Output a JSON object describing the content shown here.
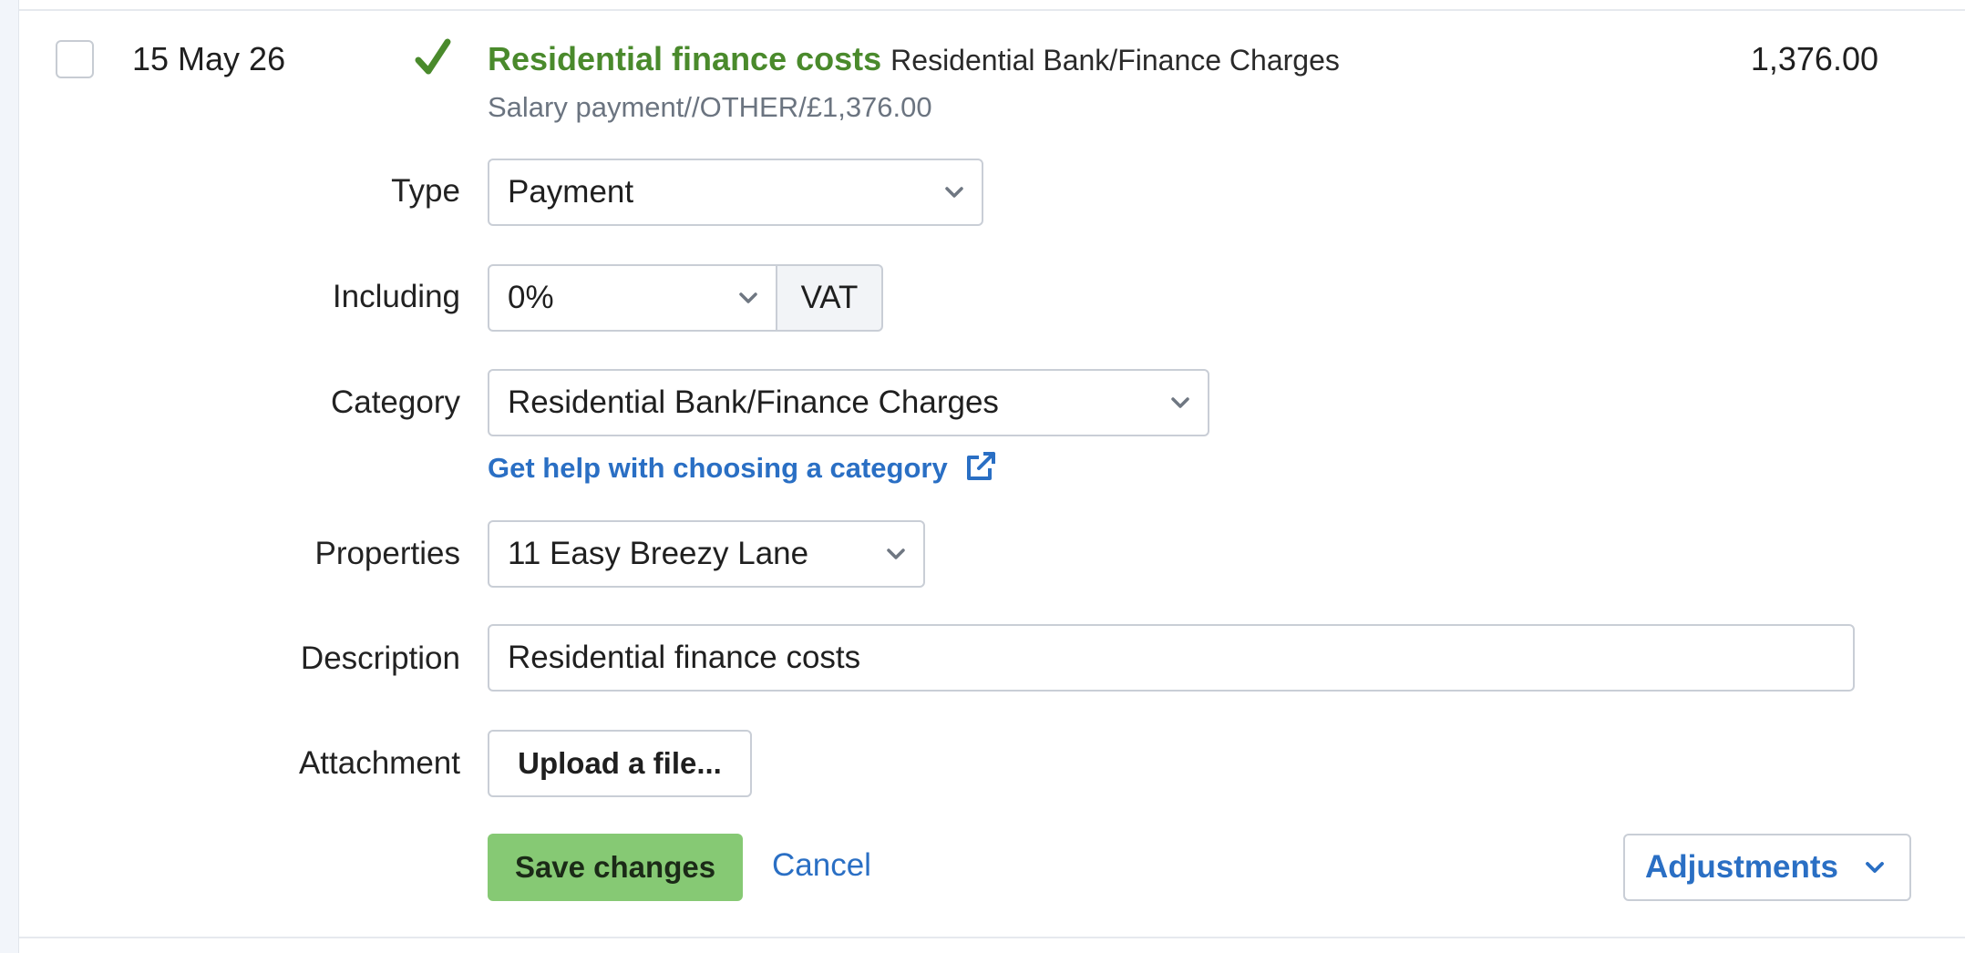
{
  "transaction": {
    "date": "15 May 26",
    "title": "Residential finance costs",
    "category_label": "Residential Bank/Finance Charges",
    "subtitle": "Salary payment//OTHER/£1,376.00",
    "amount": "1,376.00"
  },
  "form": {
    "type": {
      "label": "Type",
      "value": "Payment"
    },
    "including": {
      "label": "Including",
      "value": "0%",
      "addon": "VAT"
    },
    "category": {
      "label": "Category",
      "value": "Residential Bank/Finance Charges",
      "help_link": "Get help with choosing a category"
    },
    "properties": {
      "label": "Properties",
      "value": "11 Easy Breezy Lane"
    },
    "description": {
      "label": "Description",
      "value": "Residential finance costs"
    },
    "attachment": {
      "label": "Attachment",
      "button": "Upload a file..."
    }
  },
  "actions": {
    "save": "Save changes",
    "cancel": "Cancel",
    "adjustments": "Adjustments"
  },
  "colors": {
    "accent_green": "#4a8a2c",
    "save_green": "#86c974",
    "link_blue": "#2a6fc4"
  }
}
